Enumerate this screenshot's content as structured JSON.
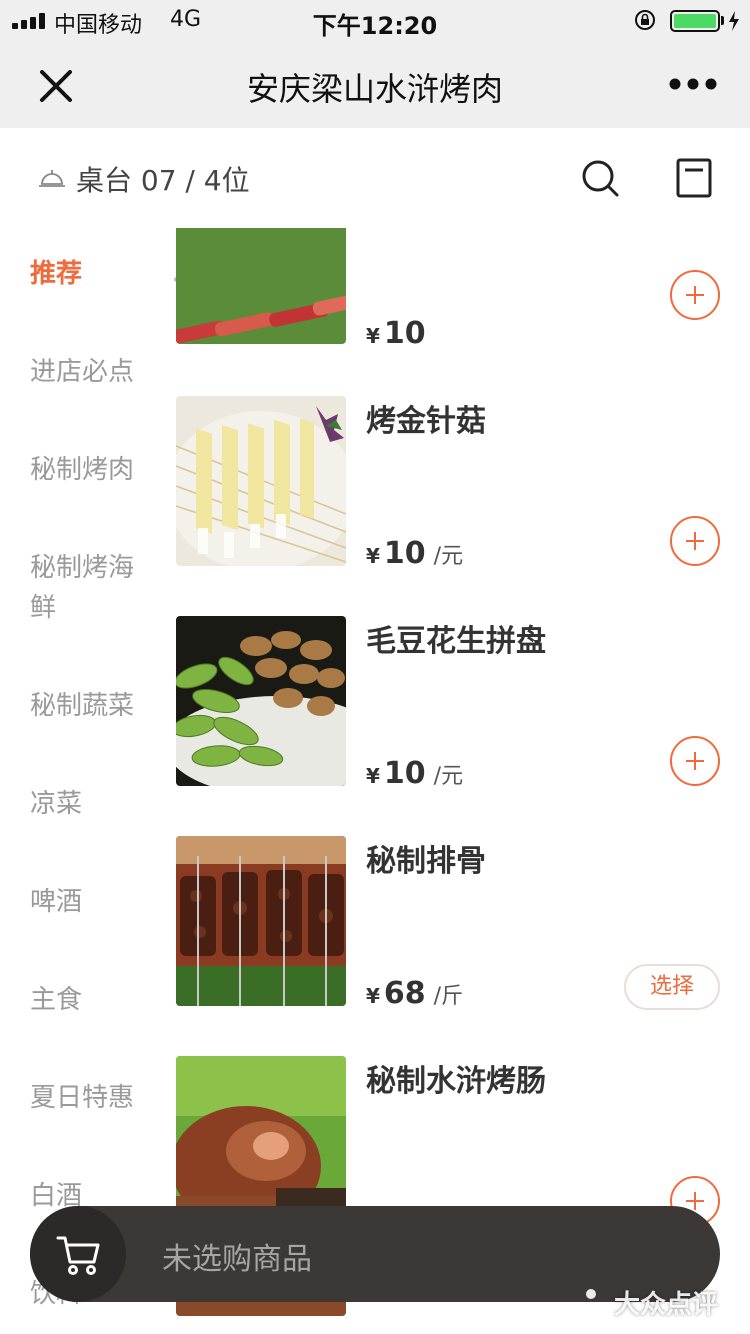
{
  "status_bar": {
    "carrier": "中国移动",
    "network": "4G",
    "time": "下午12:20",
    "battery_level": 1.0
  },
  "nav": {
    "title": "安庆梁山水浒烤肉",
    "close_icon": "close-icon",
    "more_icon": "more-icon"
  },
  "table": {
    "label": "桌台 07 / 4位",
    "bell_icon": "service-bell-icon",
    "search_icon": "search-icon",
    "order_icon": "order-list-icon"
  },
  "sidebar": {
    "active_index": 0,
    "items": [
      {
        "label": "推荐"
      },
      {
        "label": "进店必点"
      },
      {
        "label": "秘制烤肉"
      },
      {
        "label": "秘制烤海\n鲜"
      },
      {
        "label": "秘制蔬菜"
      },
      {
        "label": "凉菜"
      },
      {
        "label": "啤酒"
      },
      {
        "label": "主食"
      },
      {
        "label": "夏日特惠"
      },
      {
        "label": "白酒"
      },
      {
        "label": "饮料"
      }
    ]
  },
  "content": {
    "section_title": "推荐",
    "items": [
      {
        "name": "",
        "yen": "¥",
        "price": "10",
        "unit": "",
        "action": "add"
      },
      {
        "name": "烤金针菇",
        "yen": "¥",
        "price": "10",
        "unit": "/元",
        "action": "add"
      },
      {
        "name": "毛豆花生拼盘",
        "yen": "¥",
        "price": "10",
        "unit": "/元",
        "action": "add"
      },
      {
        "name": "秘制排骨",
        "yen": "¥",
        "price": "68",
        "unit": "/斤",
        "action": "select",
        "action_label": "选择"
      },
      {
        "name": "秘制水浒烤肠",
        "yen": "¥",
        "price": "",
        "unit": "",
        "action": "add"
      }
    ]
  },
  "cart": {
    "empty_text": "未选购商品",
    "icon": "cart-icon"
  },
  "watermark": {
    "text": "大众点评"
  },
  "colors": {
    "accent": "#f06b3c",
    "cart_bar": "#3b3836",
    "nav_bg": "#efefef"
  }
}
